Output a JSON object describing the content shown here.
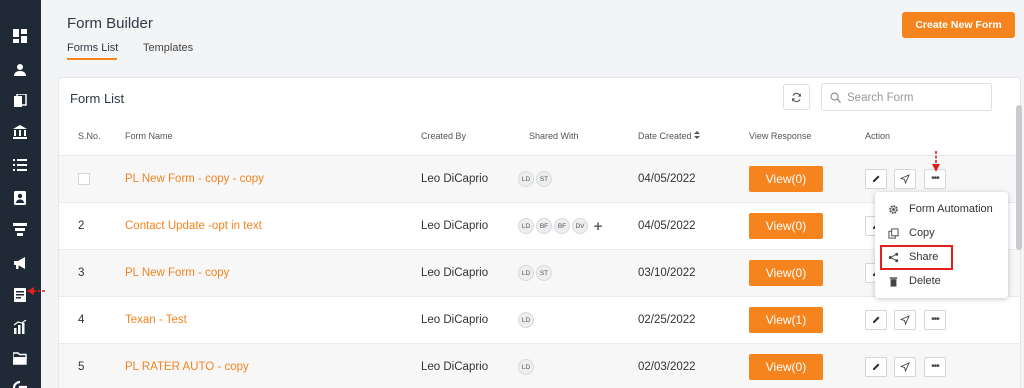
{
  "app": {
    "title": "Form Builder"
  },
  "header": {
    "tabs": [
      {
        "label": "Forms List",
        "active": true
      },
      {
        "label": "Templates",
        "active": false
      }
    ],
    "create_button": "Create New Form"
  },
  "sidebar": {
    "icons": [
      "dashboard-icon",
      "contacts-icon",
      "documents-icon",
      "bank-icon",
      "list-icon",
      "contact-card-icon",
      "funnel-icon",
      "megaphone-icon",
      "form-icon",
      "analytics-icon",
      "folder-icon",
      "google-icon"
    ]
  },
  "card": {
    "title": "Form List",
    "search_placeholder": "Search Form"
  },
  "table": {
    "columns": [
      "S.No.",
      "Form Name",
      "Created By",
      "Shared With",
      "Date Created",
      "View Response",
      "Action"
    ],
    "rows": [
      {
        "sno": "",
        "name": "PL New Form - copy - copy",
        "created_by": "Leo DiCaprio",
        "shared": [
          "LD",
          "ST"
        ],
        "date": "04/05/2022",
        "view": "View(0)"
      },
      {
        "sno": "2",
        "name": "Contact Update -opt in text",
        "created_by": "Leo DiCaprio",
        "shared": [
          "LD",
          "BF",
          "BF",
          "DV"
        ],
        "date": "04/05/2022",
        "view": "View(0)"
      },
      {
        "sno": "3",
        "name": "PL New Form - copy",
        "created_by": "Leo DiCaprio",
        "shared": [
          "LD",
          "ST"
        ],
        "date": "03/10/2022",
        "view": "View(0)"
      },
      {
        "sno": "4",
        "name": "Texan - Test",
        "created_by": "Leo DiCaprio",
        "shared": [
          "LD"
        ],
        "date": "02/25/2022",
        "view": "View(1)"
      },
      {
        "sno": "5",
        "name": "PL RATER AUTO - copy",
        "created_by": "Leo DiCaprio",
        "shared": [
          "LD"
        ],
        "date": "02/03/2022",
        "view": "View(0)"
      }
    ]
  },
  "dropdown": {
    "items": [
      {
        "label": "Form Automation",
        "icon": "gear-icon"
      },
      {
        "label": "Copy",
        "icon": "copy-icon"
      },
      {
        "label": "Share",
        "icon": "share-icon"
      },
      {
        "label": "Delete",
        "icon": "trash-icon"
      }
    ]
  },
  "colors": {
    "accent": "#f5841f",
    "sidebar": "#1f2a36",
    "annotation": "#e0211b"
  }
}
